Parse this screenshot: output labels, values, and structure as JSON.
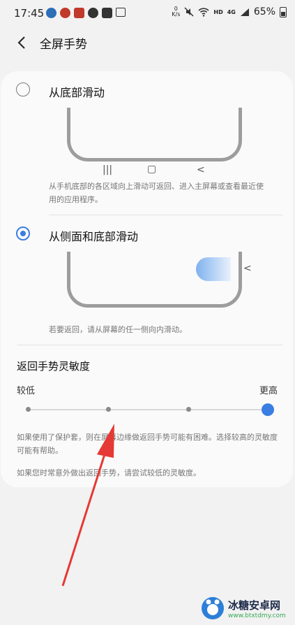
{
  "status_bar": {
    "time": "17:45",
    "net_speed": "0\nK/s",
    "hd": "HD",
    "lte": "4G",
    "battery": "65%"
  },
  "header": {
    "title": "全屏手势"
  },
  "option_bottom": {
    "label": "从底部滑动",
    "selected": false,
    "description": "从手机底部的各区域向上滑动可返回、进入主屏幕或查看最近使用的应用程序。",
    "nav_keys": [
      "|||",
      "▢",
      "<"
    ]
  },
  "option_side": {
    "label": "从侧面和底部滑动",
    "selected": true,
    "description": "若要返回，请从屏幕的任一侧向内滑动。",
    "side_glyph": "<"
  },
  "sensitivity": {
    "title": "返回手势灵敏度",
    "min_label": "较低",
    "max_label": "更高",
    "level": 4,
    "levels": 4,
    "note1": "如果使用了保护套，则在屏幕边缘做返回手势可能有困难。选择较高的灵敏度可能有帮助。",
    "note2": "如果您时常意外做出返回手势，请尝试较低的灵敏度。"
  },
  "watermark": {
    "title": "冰糖安卓网",
    "url": "www.btxtdmy.com"
  },
  "colors": {
    "accent": "#3a7ee3",
    "arrow": "#e53935"
  }
}
